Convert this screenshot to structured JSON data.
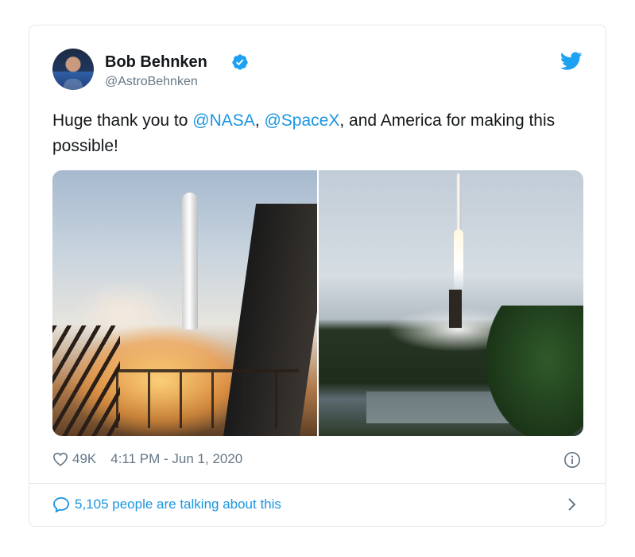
{
  "author": {
    "name": "Bob Behnken",
    "handle": "@AstroBehnken"
  },
  "tweet": {
    "text_before": "Huge thank you to ",
    "mention1": "@NASA",
    "sep": ", ",
    "mention2": "@SpaceX",
    "text_after": ", and America for making this possible!"
  },
  "meta": {
    "likes": "49K",
    "timestamp": "4:11 PM - Jun 1, 2020"
  },
  "footer": {
    "talking": "5,105 people are talking about this"
  },
  "icons": {
    "verified": "verified-badge-icon",
    "brand": "twitter-bird-icon",
    "like": "heart-icon",
    "info": "info-icon",
    "reply": "speech-bubble-icon",
    "more": "chevron-right-icon"
  },
  "colors": {
    "link": "#1b95e0",
    "muted": "#657786",
    "text": "#14171a",
    "border": "#e1e8ed"
  }
}
